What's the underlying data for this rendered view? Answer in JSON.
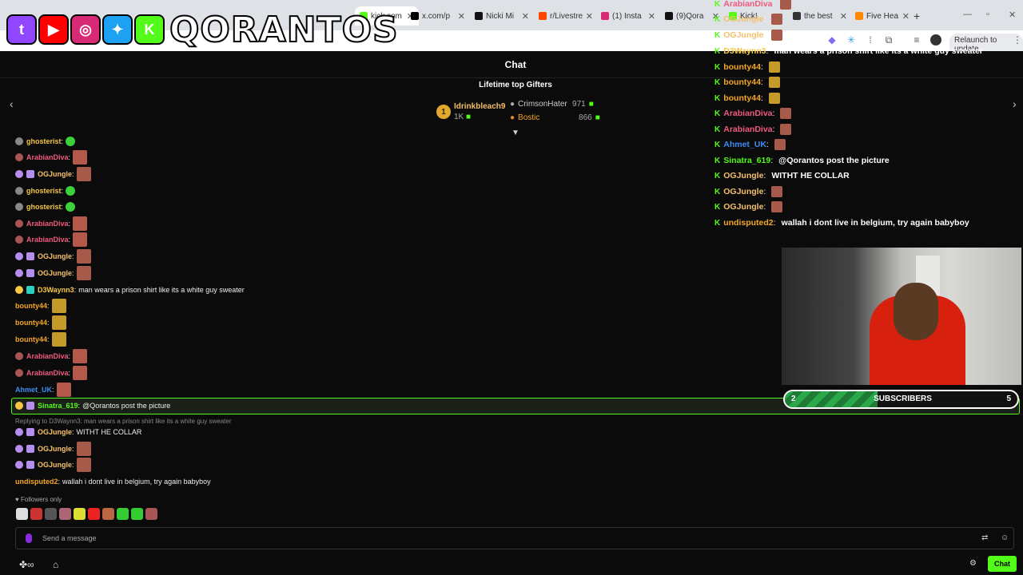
{
  "browser": {
    "tabs": [
      {
        "title": "kick.com",
        "fav": "#53fc18",
        "active": true
      },
      {
        "title": "x.com/p",
        "fav": "#000000"
      },
      {
        "title": "Nicki Mi",
        "fav": "#111111"
      },
      {
        "title": "r/Livestre",
        "fav": "#ff4500"
      },
      {
        "title": "(1) Insta",
        "fav": "#d62976"
      },
      {
        "title": "(9)Qora",
        "fav": "#111111"
      },
      {
        "title": "Kick!",
        "fav": "#53fc18"
      },
      {
        "title": "the best",
        "fav": "#333333"
      },
      {
        "title": "Five Hea",
        "fav": "#ff8800"
      }
    ],
    "new_tab": "+",
    "relaunch_label": "Relaunch to update"
  },
  "logo": {
    "socials": [
      {
        "name": "twitch-icon",
        "color": "#9146ff",
        "glyph": "t"
      },
      {
        "name": "youtube-icon",
        "color": "#ff0000",
        "glyph": "▶"
      },
      {
        "name": "instagram-icon",
        "color": "#d62976",
        "glyph": "◎"
      },
      {
        "name": "twitter-icon",
        "color": "#1da1f2",
        "glyph": "✦"
      },
      {
        "name": "kick-icon",
        "color": "#53fc18",
        "glyph": "K"
      }
    ],
    "text": "QORANTOS"
  },
  "chat": {
    "title": "Chat",
    "gifters_title": "Lifetime top Gifters",
    "gifters": [
      {
        "rank": "1",
        "name": "Idrinkbleach9",
        "count": "1K"
      },
      {
        "name": "CrimsonHater",
        "count": "971"
      },
      {
        "name": "Bostic",
        "count": "866"
      }
    ],
    "messages": [
      {
        "user": "ghosterist",
        "color": "#f6c744",
        "text": "",
        "emote": "#3cd13c"
      },
      {
        "user": "ArabianDiva",
        "color": "#f05a7e",
        "text": "",
        "emote": "#b3584a"
      },
      {
        "user": "OGJungle",
        "color": "#f5c06a",
        "text": "",
        "emote": "#a85a4a"
      },
      {
        "user": "ghosterist",
        "color": "#f6c744",
        "text": "",
        "emote": "#3cd13c"
      },
      {
        "user": "ghosterist",
        "color": "#f6c744",
        "text": "",
        "emote": "#3cd13c"
      },
      {
        "user": "ArabianDiva",
        "color": "#f05a7e",
        "text": "",
        "emote": "#b3584a"
      },
      {
        "user": "ArabianDiva",
        "color": "#f05a7e",
        "text": "",
        "emote": "#b3584a"
      },
      {
        "user": "OGJungle",
        "color": "#f5c06a",
        "text": "",
        "emote": "#a85a4a"
      },
      {
        "user": "OGJungle",
        "color": "#f5c06a",
        "text": "",
        "emote": "#a85a4a"
      },
      {
        "user": "D3Waynn3",
        "color": "#f6c744",
        "text": "man wears a prison shirt like its a white guy sweater"
      },
      {
        "user": "bounty44",
        "color": "#f5a623",
        "text": "",
        "emote": "#c49a2a"
      },
      {
        "user": "bounty44",
        "color": "#f5a623",
        "text": "",
        "emote": "#c49a2a"
      },
      {
        "user": "bounty44",
        "color": "#f5a623",
        "text": "",
        "emote": "#c49a2a"
      },
      {
        "user": "ArabianDiva",
        "color": "#f05a7e",
        "text": "",
        "emote": "#b3584a"
      },
      {
        "user": "ArabianDiva",
        "color": "#f05a7e",
        "text": "",
        "emote": "#b3584a"
      },
      {
        "user": "Ahmet_UK",
        "color": "#3b8df0",
        "text": "",
        "emote": "#b3584a"
      },
      {
        "user": "Sinatra_619",
        "color": "#53fc18",
        "text": "@Qorantos post the picture"
      },
      {
        "user": "OGJungle",
        "color": "#f5c06a",
        "text": "WITHT HE COLLAR"
      },
      {
        "user": "OGJungle",
        "color": "#f5c06a",
        "text": "",
        "emote": "#a85a4a"
      },
      {
        "user": "OGJungle",
        "color": "#f5c06a",
        "text": "",
        "emote": "#a85a4a"
      },
      {
        "user": "undisputed2",
        "color": "#f5a623",
        "text": "wallah i dont live in belgium, try again babyboy"
      }
    ],
    "reply_label": "Replying to D3Waynn3: man wears a prison shirt like its a white guy sweater",
    "followers_only": "Followers only",
    "input_placeholder": "Send a message",
    "chat_button": "Chat"
  },
  "overlay": {
    "messages": [
      {
        "user": "ArabianDiva",
        "color": "#f05a7e",
        "text": ""
      },
      {
        "user": "OGJungle",
        "color": "#f5c06a",
        "text": ""
      },
      {
        "user": "OGJungle",
        "color": "#f5c06a",
        "text": ""
      },
      {
        "user": "D3Waynn3",
        "color": "#f6c744",
        "text": "man wears a prison shirt like its a white guy sweater"
      },
      {
        "user": "bounty44",
        "color": "#f5a623",
        "text": ""
      },
      {
        "user": "bounty44",
        "color": "#f5a623",
        "text": ""
      },
      {
        "user": "bounty44",
        "color": "#f5a623",
        "text": ""
      },
      {
        "user": "ArabianDiva",
        "color": "#f05a7e",
        "text": ""
      },
      {
        "user": "ArabianDiva",
        "color": "#f05a7e",
        "text": ""
      },
      {
        "user": "Ahmet_UK",
        "color": "#3b8df0",
        "text": ""
      },
      {
        "user": "Sinatra_619",
        "color": "#53fc18",
        "text": "@Qorantos post the picture"
      },
      {
        "user": "OGJungle",
        "color": "#f5c06a",
        "text": "WITHT HE COLLAR"
      },
      {
        "user": "OGJungle",
        "color": "#f5c06a",
        "text": ""
      },
      {
        "user": "OGJungle",
        "color": "#f5c06a",
        "text": ""
      },
      {
        "user": "undisputed2",
        "color": "#f5a623",
        "text": "wallah i dont live in belgium, try again babyboy"
      }
    ]
  },
  "subgoal": {
    "current": "2",
    "label": "SUBSCRIBERS",
    "target": "5",
    "progress": 0.4
  }
}
